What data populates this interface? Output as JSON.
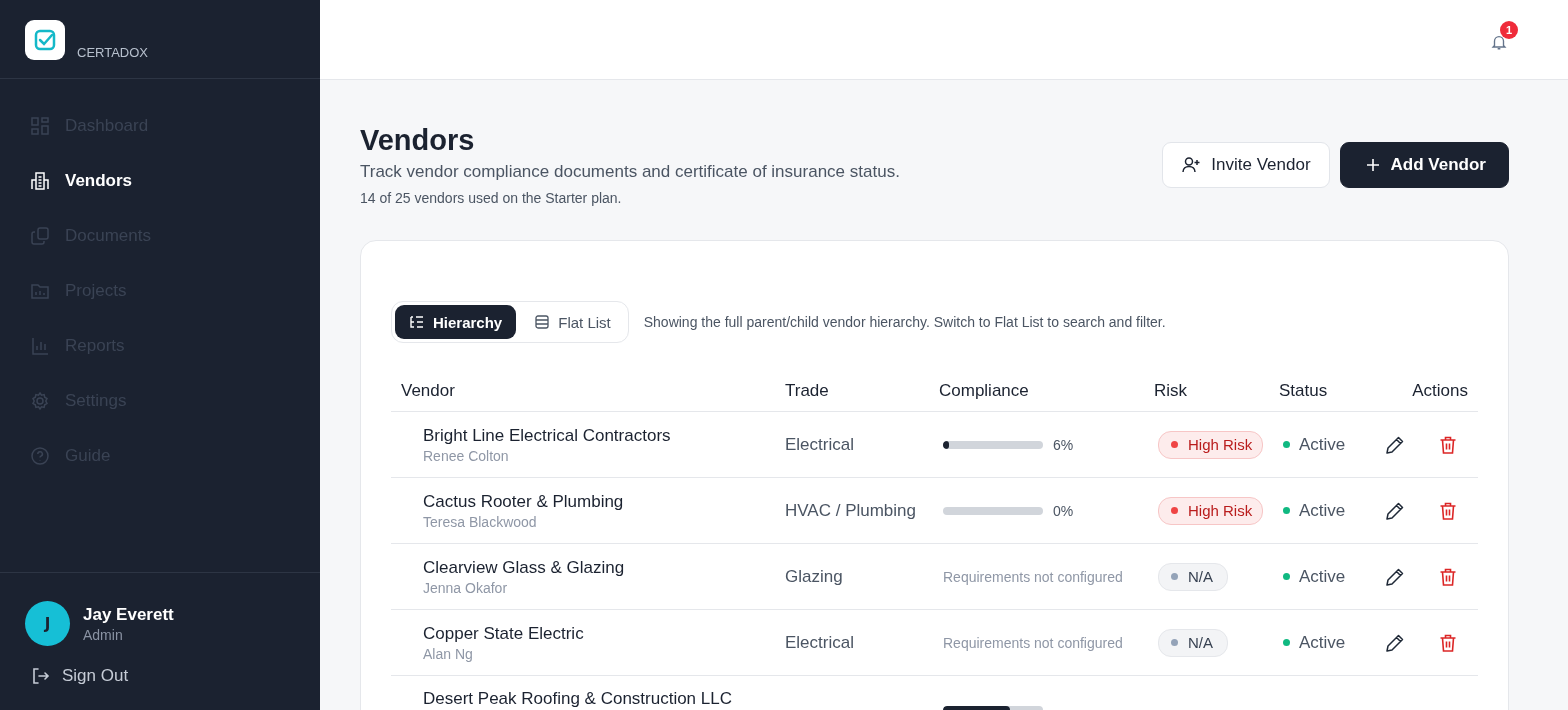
{
  "brand": {
    "name": "CERTADOX"
  },
  "sidebar": {
    "items": [
      {
        "label": "Dashboard",
        "selected": false
      },
      {
        "label": "Vendors",
        "selected": true
      },
      {
        "label": "Documents",
        "selected": false
      },
      {
        "label": "Projects",
        "selected": false
      },
      {
        "label": "Reports",
        "selected": false
      },
      {
        "label": "Settings",
        "selected": false
      },
      {
        "label": "Guide",
        "selected": false
      }
    ]
  },
  "user": {
    "initial": "J",
    "name": "Jay Everett",
    "role": "Admin",
    "sign_out": "Sign Out"
  },
  "notifications": {
    "count": "1"
  },
  "page": {
    "title": "Vendors",
    "subtitle": "Track vendor compliance documents and certificate of insurance status.",
    "usage": "14 of 25 vendors used on the Starter plan.",
    "buttons": [
      {
        "label": "Invite Vendor",
        "kind": "secondary"
      },
      {
        "label": "Add Vendor",
        "kind": "primary"
      }
    ]
  },
  "view_toggle": {
    "options": [
      {
        "label": "Hierarchy",
        "selected": true
      },
      {
        "label": "Flat List",
        "selected": false
      }
    ],
    "hint": "Showing the full parent/child vendor hierarchy. Switch to Flat List to search and filter."
  },
  "table": {
    "columns": [
      "Vendor",
      "Trade",
      "Compliance",
      "Risk",
      "Status",
      "Actions"
    ],
    "rows": [
      {
        "vendor": "Bright Line Electrical Contractors",
        "contact": "Renee Colton",
        "trade": "Electrical",
        "compliance": {
          "kind": "progress",
          "level": 0.06,
          "reading": "6%"
        },
        "risk": {
          "label": "High Risk",
          "kind": "high",
          "color": "#ef4444"
        },
        "status": {
          "label": "Active",
          "color": "#10b981"
        }
      },
      {
        "vendor": "Cactus Rooter & Plumbing",
        "contact": "Teresa Blackwood",
        "trade": "HVAC / Plumbing",
        "compliance": {
          "kind": "progress",
          "reading": "0%"
        },
        "risk": {
          "label": "High Risk",
          "kind": "high",
          "color": "#ef4444"
        },
        "status": {
          "label": "Active",
          "color": "#10b981"
        }
      },
      {
        "vendor": "Clearview Glass & Glazing",
        "contact": "Jenna Okafor",
        "trade": "Glazing",
        "compliance": {
          "kind": "note",
          "text": "Requirements not configured"
        },
        "risk": {
          "label": "N/A",
          "kind": "none",
          "color": "#94a3b8"
        },
        "status": {
          "label": "Active",
          "color": "#10b981"
        }
      },
      {
        "vendor": "Copper State Electric",
        "contact": "Alan Ng",
        "trade": "Electrical",
        "compliance": {
          "kind": "note",
          "text": "Requirements not configured"
        },
        "risk": {
          "label": "N/A",
          "kind": "none",
          "color": "#94a3b8"
        },
        "status": {
          "label": "Active",
          "color": "#10b981"
        }
      },
      {
        "vendor": "Desert Peak Roofing & Construction LLC",
        "compliance": {
          "kind": "progress",
          "level": 0.67
        }
      }
    ]
  }
}
